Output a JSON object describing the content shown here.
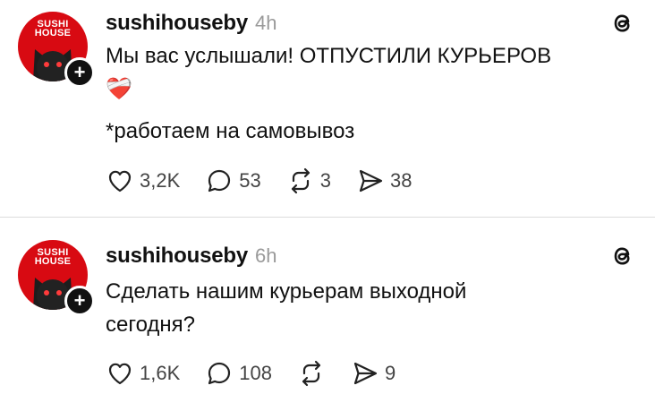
{
  "posts": [
    {
      "avatar_text_line1": "SUSHI",
      "avatar_text_line2": "HOUSE",
      "username": "sushihouseby",
      "time": "4h",
      "text_line1": "Мы вас услышали! ОТПУСТИЛИ КУРЬЕРОВ",
      "emoji": "❤️‍🩹",
      "text_line3": "*работаем на самовывоз",
      "likes": "3,2K",
      "comments": "53",
      "reposts": "3",
      "shares": "38"
    },
    {
      "avatar_text_line1": "SUSHI",
      "avatar_text_line2": "HOUSE",
      "username": "sushihouseby",
      "time": "6h",
      "text_line1": "Сделать нашим курьерам выходной",
      "text_line2": "сегодня?",
      "likes": "1,6K",
      "comments": "108",
      "shares": "9"
    }
  ],
  "colors": {
    "brand": "#d80a12",
    "text": "#111111",
    "muted": "#9a9a9a"
  },
  "icons": [
    "threads-icon",
    "heart-icon",
    "comment-icon",
    "repost-icon",
    "share-icon",
    "plus-icon"
  ]
}
